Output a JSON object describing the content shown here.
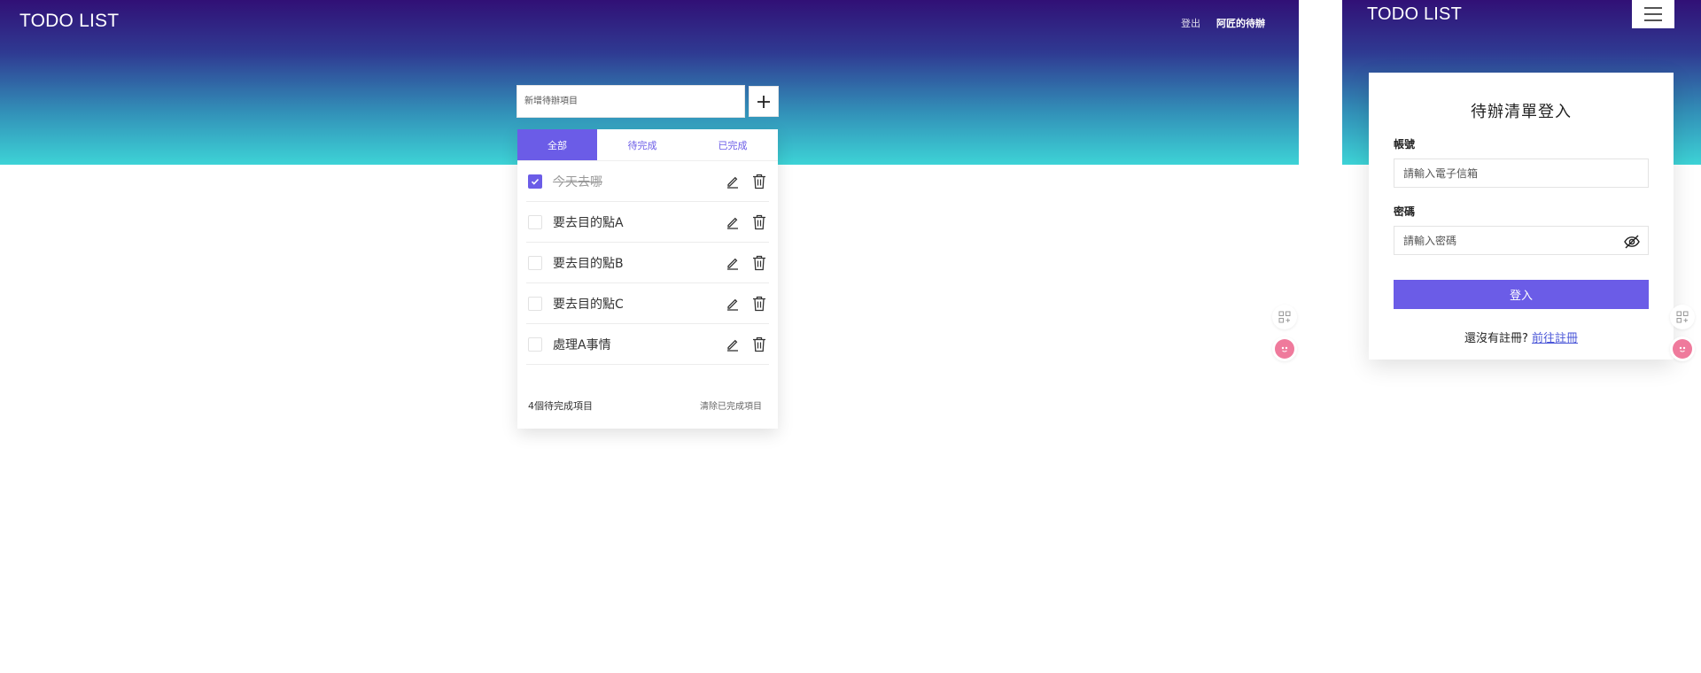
{
  "desktop": {
    "brand": "TODO LIST",
    "nav": {
      "logout": "登出",
      "user": "阿匠的待辦"
    },
    "add_placeholder": "新增待辦項目",
    "tabs": [
      {
        "label": "全部"
      },
      {
        "label": "待完成"
      },
      {
        "label": "已完成"
      }
    ],
    "items": [
      {
        "text": "今天去哪",
        "done": true
      },
      {
        "text": "要去目的點A",
        "done": false
      },
      {
        "text": "要去目的點B",
        "done": false
      },
      {
        "text": "要去目的點C",
        "done": false
      },
      {
        "text": "處理A事情",
        "done": false
      }
    ],
    "footer": {
      "count": "4個待完成項目",
      "clear": "清除已完成項目"
    }
  },
  "mobile": {
    "brand": "TODO LIST",
    "login": {
      "title": "待辦清單登入",
      "account_label": "帳號",
      "account_placeholder": "請輸入電子信箱",
      "password_label": "密碼",
      "password_placeholder": "請輸入密碼",
      "submit": "登入",
      "register_prompt": "還沒有註冊?",
      "register_link": "前往註冊"
    }
  },
  "colors": {
    "accent": "#6b5ce7",
    "gradient_top": "#311076",
    "gradient_bottom": "#3dd3d6"
  }
}
